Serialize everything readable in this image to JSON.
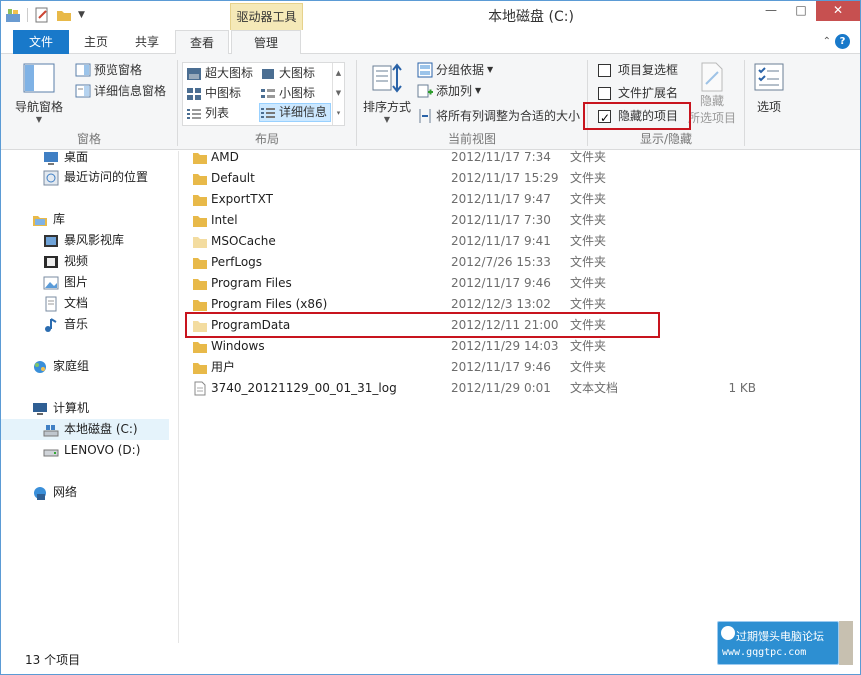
{
  "window": {
    "title": "本地磁盘 (C:)",
    "context_tab_header": "驱动器工具",
    "controls": {
      "minimize": "—",
      "maximize": "□",
      "close": "✕"
    }
  },
  "tabs": {
    "file": "文件",
    "home": "主页",
    "share": "共享",
    "view": "查看",
    "manage": "管理"
  },
  "ribbon": {
    "panes": {
      "label": "窗格",
      "nav_pane": "导航窗格",
      "preview_pane": "预览窗格",
      "details_pane": "详细信息窗格"
    },
    "layout": {
      "label": "布局",
      "extra_large": "超大图标",
      "large": "大图标",
      "medium": "中图标",
      "small": "小图标",
      "list": "列表",
      "details": "详细信息"
    },
    "current_view": {
      "label": "当前视图",
      "sort_by": "排序方式",
      "group_by": "分组依据",
      "add_columns": "添加列",
      "fit_columns": "将所有列调整为合适的大小"
    },
    "show_hide": {
      "label": "显示/隐藏",
      "item_checkboxes": "项目复选框",
      "item_checkboxes_checked": false,
      "file_extensions": "文件扩展名",
      "file_extensions_checked": false,
      "hidden_items": "隐藏的项目",
      "hidden_items_checked": true,
      "hide_selected_line1": "隐藏",
      "hide_selected_line2": "所选项目"
    },
    "options": "选项"
  },
  "nav": {
    "items": [
      {
        "label": "桌面",
        "icon": "desktop-icon"
      },
      {
        "label": "最近访问的位置",
        "icon": "recent-places-icon"
      },
      {
        "label": "库",
        "icon": "library-icon"
      },
      {
        "label": "暴风影视库",
        "icon": "video-library-icon"
      },
      {
        "label": "视频",
        "icon": "video-icon"
      },
      {
        "label": "图片",
        "icon": "pictures-icon"
      },
      {
        "label": "文档",
        "icon": "documents-icon"
      },
      {
        "label": "音乐",
        "icon": "music-icon"
      },
      {
        "label": "家庭组",
        "icon": "homegroup-icon"
      },
      {
        "label": "计算机",
        "icon": "computer-icon"
      },
      {
        "label": "本地磁盘 (C:)",
        "icon": "local-disk-icon"
      },
      {
        "label": "LENOVO (D:)",
        "icon": "drive-icon"
      },
      {
        "label": "网络",
        "icon": "network-icon"
      }
    ]
  },
  "files": [
    {
      "name": "AMD",
      "date": "2012/11/17 7:34",
      "type": "文件夹",
      "size": ""
    },
    {
      "name": "Default",
      "date": "2012/11/17 15:29",
      "type": "文件夹",
      "size": ""
    },
    {
      "name": "ExportTXT",
      "date": "2012/11/17 9:47",
      "type": "文件夹",
      "size": ""
    },
    {
      "name": "Intel",
      "date": "2012/11/17 7:30",
      "type": "文件夹",
      "size": ""
    },
    {
      "name": "MSOCache",
      "date": "2012/11/17 9:41",
      "type": "文件夹",
      "size": ""
    },
    {
      "name": "PerfLogs",
      "date": "2012/7/26 15:33",
      "type": "文件夹",
      "size": ""
    },
    {
      "name": "Program Files",
      "date": "2012/11/17 9:46",
      "type": "文件夹",
      "size": ""
    },
    {
      "name": "Program Files (x86)",
      "date": "2012/12/3 13:02",
      "type": "文件夹",
      "size": ""
    },
    {
      "name": "ProgramData",
      "date": "2012/12/11 21:00",
      "type": "文件夹",
      "size": ""
    },
    {
      "name": "Windows",
      "date": "2012/11/29 14:03",
      "type": "文件夹",
      "size": ""
    },
    {
      "name": "用户",
      "date": "2012/11/17 9:46",
      "type": "文件夹",
      "size": ""
    },
    {
      "name": "3740_20121129_00_01_31_log",
      "date": "2012/11/29 0:01",
      "type": "文本文档",
      "size": "1 KB"
    }
  ],
  "status": {
    "item_count": "13 个项目"
  },
  "watermark": {
    "line1": "过期馒头电脑论坛",
    "line2": "www.gqgtpc.com",
    "side": "过期馒头"
  },
  "colors": {
    "accent": "#1979ca",
    "highlight_box": "#c8141e",
    "folder": "#e8b949"
  }
}
